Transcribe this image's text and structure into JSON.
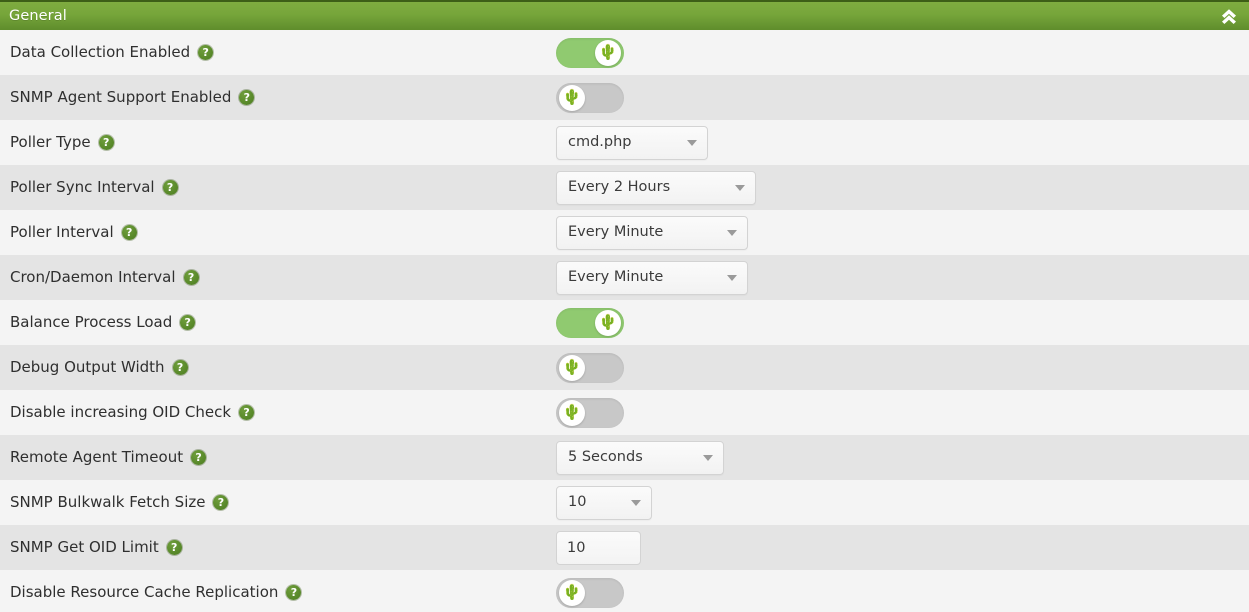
{
  "panel": {
    "title": "General",
    "collapse_icon": "double-chevron-up-icon",
    "header_color": "#76a53a",
    "header_border_color": "#3d5e17"
  },
  "icons": {
    "help": "?",
    "cactus": "🌵"
  },
  "colors": {
    "toggle_on": "#90ca70",
    "toggle_off": "#c8c8c8",
    "row_odd": "#f4f4f4",
    "row_even": "#e4e4e4",
    "help_green": "#4b7c1f"
  },
  "settings": [
    {
      "label": "Data Collection Enabled",
      "help": "?",
      "control": "toggle",
      "state": "on",
      "value": "On"
    },
    {
      "label": "SNMP Agent Support Enabled",
      "help": "?",
      "control": "toggle",
      "state": "off",
      "value": "Off"
    },
    {
      "label": "Poller Type",
      "help": "?",
      "control": "select",
      "value": "cmd.php",
      "width_class": "w-cmdphp"
    },
    {
      "label": "Poller Sync Interval",
      "help": "?",
      "control": "select",
      "value": "Every 2 Hours",
      "width_class": "w-sync"
    },
    {
      "label": "Poller Interval",
      "help": "?",
      "control": "select",
      "value": "Every Minute",
      "width_class": "w-interval"
    },
    {
      "label": "Cron/Daemon Interval",
      "help": "?",
      "control": "select",
      "value": "Every Minute",
      "width_class": "w-interval"
    },
    {
      "label": "Balance Process Load",
      "help": "?",
      "control": "toggle",
      "state": "on",
      "value": "On"
    },
    {
      "label": "Debug Output Width",
      "help": "?",
      "control": "toggle",
      "state": "off",
      "value": "Off"
    },
    {
      "label": "Disable increasing OID Check",
      "help": "?",
      "control": "toggle",
      "state": "off",
      "value": "Off"
    },
    {
      "label": "Remote Agent Timeout",
      "help": "?",
      "control": "select",
      "value": "5 Seconds",
      "width_class": "w-timeout"
    },
    {
      "label": "SNMP Bulkwalk Fetch Size",
      "help": "?",
      "control": "select",
      "value": "10",
      "width_class": "w-bulk"
    },
    {
      "label": "SNMP Get OID Limit",
      "help": "?",
      "control": "input",
      "value": "10"
    },
    {
      "label": "Disable Resource Cache Replication",
      "help": "?",
      "control": "toggle",
      "state": "off",
      "value": "Off"
    }
  ]
}
